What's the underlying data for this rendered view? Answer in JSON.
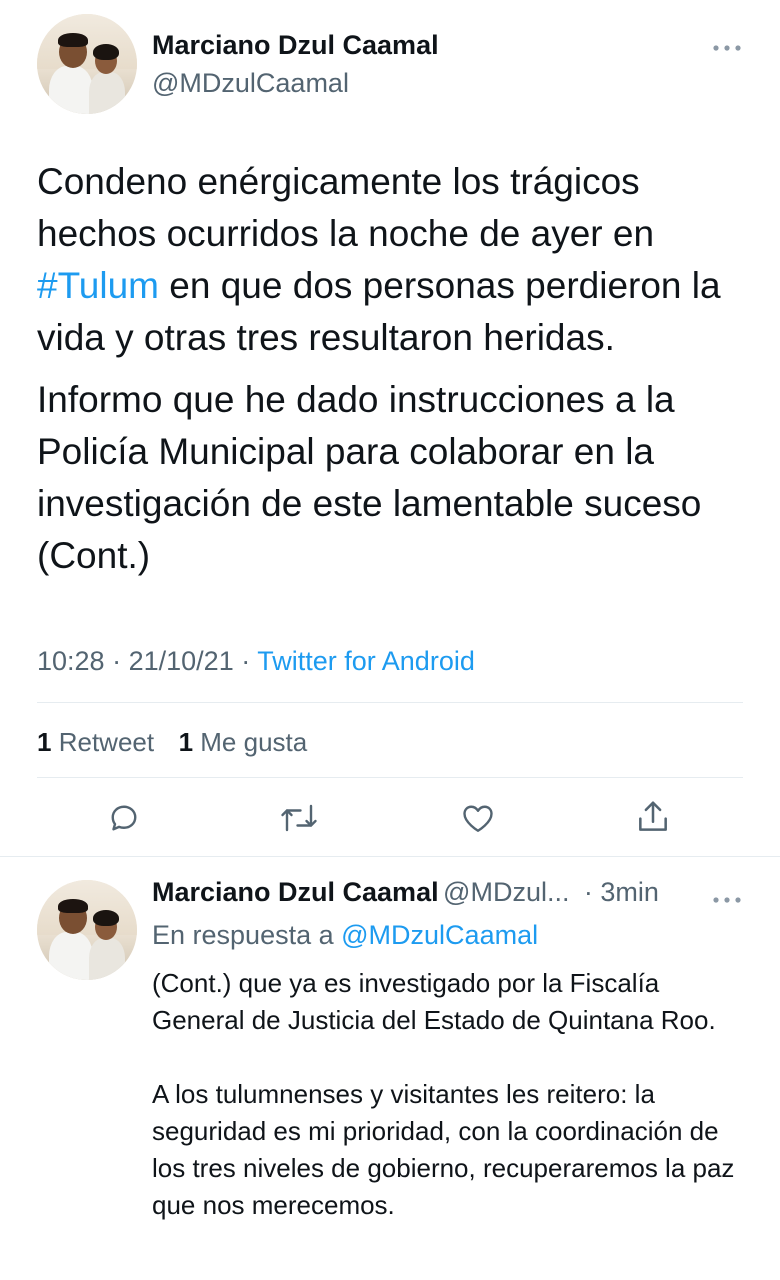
{
  "main_tweet": {
    "author_name": "Marciano Dzul Caamal",
    "author_handle": "@MDzulCaamal",
    "more_icon": "more-dots-icon",
    "paragraph1_a": "Condeno enérgicamente los trágicos hechos ocurridos la noche de ayer en",
    "hashtag": "#Tulum",
    "paragraph1_b": "en que dos personas perdieron la vida y otras tres resultaron heridas.",
    "paragraph2": "Informo que he dado instrucciones a la Policía Municipal para colaborar en la investigación de este lamentable suceso (Cont.)",
    "time": "10:28",
    "date": "21/10/21",
    "separator": "·",
    "source": "Twitter for Android",
    "retweet_count": "1",
    "retweet_label": "Retweet",
    "like_count": "1",
    "like_label": "Me gusta",
    "actions": [
      "reply-icon",
      "retweet-icon",
      "like-icon",
      "share-icon"
    ]
  },
  "reply_tweet": {
    "author_name": "Marciano Dzul Caamal",
    "author_handle": "@MDzul...",
    "time": "· 3min",
    "in_reply_prefix": "En respuesta a",
    "in_reply_handle": "@MDzulCaamal",
    "paragraph1": "(Cont.) que ya es investigado por la Fiscalía General de Justicia del Estado de Quintana Roo.",
    "paragraph2": "A los tulumnenses y visitantes les reitero: la seguridad es mi prioridad, con la coordinación de los tres niveles de gobierno, recuperaremos la paz que nos merecemos."
  },
  "colors": {
    "link": "#1d9bf0",
    "text": "#0f1419",
    "muted": "#536471",
    "divider": "#e6ecf0"
  }
}
